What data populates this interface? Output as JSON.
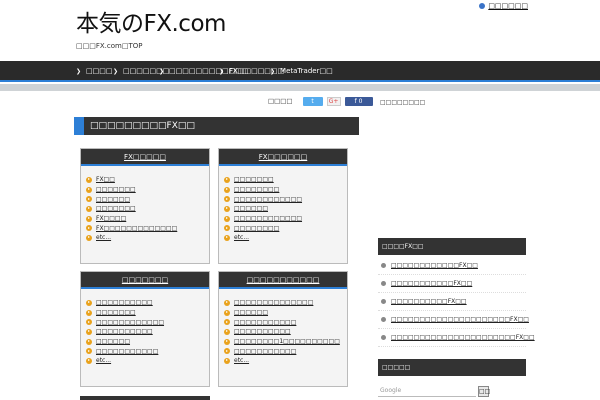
{
  "header": {
    "title": "本気のFX.com",
    "subtitle": "□□□FX.com□TOP",
    "top_link": "□□□□□□"
  },
  "nav": {
    "items": [
      {
        "label": "□□□□"
      },
      {
        "label": "□□□□□□□"
      },
      {
        "label": "□□□□□□□□□□□□"
      },
      {
        "label": "FX□□□□□□□"
      },
      {
        "label": "MetaTrader□□"
      }
    ]
  },
  "social": {
    "label": "□□□□",
    "twitter": "t",
    "google": "G+",
    "facebook": "f 0"
  },
  "content": {
    "title": "□□□□□□□□□FX□□",
    "boxes": [
      {
        "title": "FX□□□□□",
        "items": [
          "FX□□",
          "□□□□□□□",
          "□□□□□□",
          "□□□□□□□",
          "FX□□□□",
          "FX□□□□□□□□□□□□□",
          "etc..."
        ]
      },
      {
        "title": "FX□□□□□□",
        "items": [
          "□□□□□□□",
          "□□□□□□□□",
          "□□□□□□□□□□□□",
          "□□□□□□",
          "□□□□□□□□□□□□",
          "□□□□□□□□",
          "etc..."
        ]
      },
      {
        "title": "□□□□□□□",
        "items": [
          "□□□□□□□□□□",
          "□□□□□□□",
          "□□□□□□□□□□□□",
          "□□□□□□□□□□",
          "□□□□□□",
          "□□□□□□□□□□□",
          "etc..."
        ]
      },
      {
        "title": "□□□□□□□□□□□",
        "items": [
          "□□□□□□□□□□□□□□",
          "□□□□□□",
          "□□□□□□□□□□□",
          "□□□□□□□□□□",
          "□□□□□□□□1□□□□□□□□□□",
          "□□□□□□□□□□□",
          "etc..."
        ]
      }
    ]
  },
  "sidebar": {
    "label": "□□□□□□□□",
    "fx_widget": {
      "title": "□□□□FX□□",
      "items": [
        "□□□□□□□□□□□□FX□□",
        "□□□□□□□□□□□FX□□",
        "□□□□□□□□□□FX□□",
        "□□□□□□□□□□□□□□□□□□□□□FX□□",
        "□□□□□□□□□□□□□□□□□□□□□□FX□□"
      ]
    },
    "search_widget": {
      "title": "□□□□□",
      "placeholder": "Google",
      "button": "□□"
    }
  }
}
